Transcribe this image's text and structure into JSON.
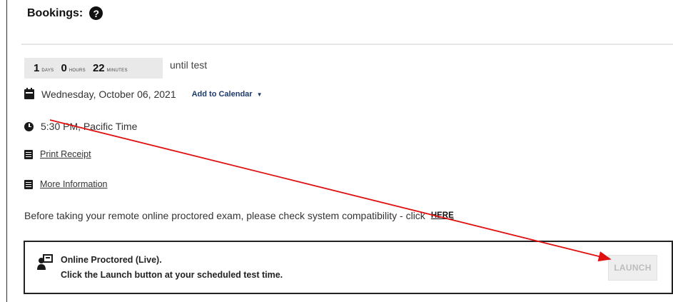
{
  "header": {
    "title": "Bookings:",
    "help_icon": "question-circle-icon"
  },
  "countdown": {
    "days_value": "1",
    "days_label": "DAYS",
    "hours_value": "0",
    "hours_label": "HOURS",
    "minutes_value": "22",
    "minutes_label": "MINUTES",
    "suffix": "until test"
  },
  "details": {
    "date": "Wednesday, October 06, 2021",
    "add_to_calendar": "Add to Calendar",
    "time": "5:30 PM, Pacific Time",
    "print_receipt": "Print Receipt",
    "more_information": "More Information",
    "compat_text": "Before taking your remote online proctored exam, please check system compatibility - click",
    "here_link": "HERE"
  },
  "exam_card": {
    "title": "Online Proctored (Live).",
    "subtitle": "Click the Launch button at your scheduled test time.",
    "launch_label": "LAUNCH",
    "launch_state": "disabled"
  },
  "colors": {
    "annotation_arrow": "#e01010",
    "launch_disabled_text": "#bdbdbd",
    "link_blue": "#1b3a6b"
  }
}
